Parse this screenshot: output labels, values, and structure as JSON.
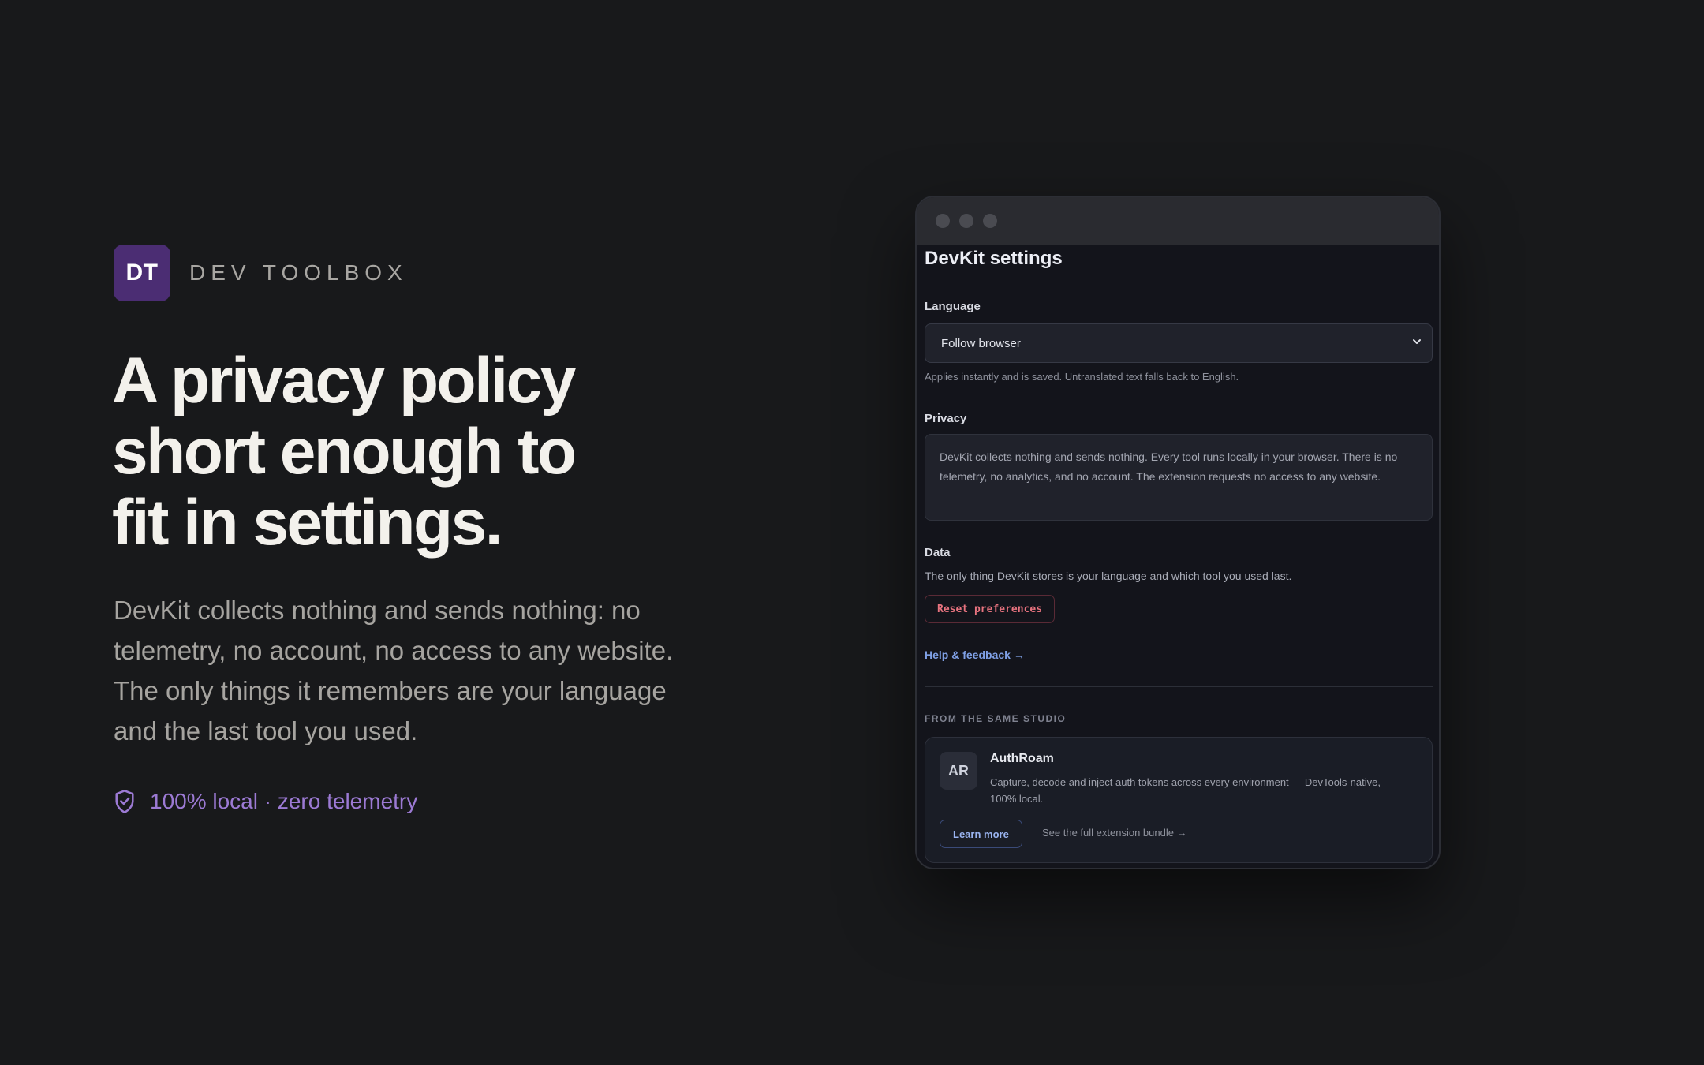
{
  "brand": {
    "logo_text": "DT",
    "name": "DEV TOOLBOX",
    "logo_color": "#4b2d73"
  },
  "hero": {
    "headline_lines": [
      "A privacy policy",
      "short enough to",
      "fit in settings."
    ],
    "lede": "DevKit collects nothing and sends nothing: no telemetry, no account, no access to any website. The only things it remembers are your language and the last tool you used.",
    "badge_icon": "shield-check-icon",
    "badge_text": "100% local · zero telemetry",
    "accent_color": "#9c7ad4"
  },
  "settings": {
    "title": "DevKit settings",
    "language": {
      "label": "Language",
      "selected": "Follow browser",
      "hint": "Applies instantly and is saved. Untranslated text falls back to English."
    },
    "privacy": {
      "label": "Privacy",
      "text": "DevKit collects nothing and sends nothing. Every tool runs locally in your browser. There is no telemetry, no analytics, and no account. The extension requests no access to any website."
    },
    "data": {
      "label": "Data",
      "text": "The only thing DevKit stores is your language and which tool you used last.",
      "reset_label": "Reset preferences"
    },
    "help_link": "Help & feedback →",
    "studio": {
      "label": "FROM THE SAME STUDIO",
      "app_initials": "AR",
      "app_name": "AuthRoam",
      "app_desc": "Capture, decode and inject auth tokens across every environment — DevTools-native, 100% local.",
      "learn_more": "Learn more",
      "bundle_link": "See the full extension bundle →"
    }
  }
}
